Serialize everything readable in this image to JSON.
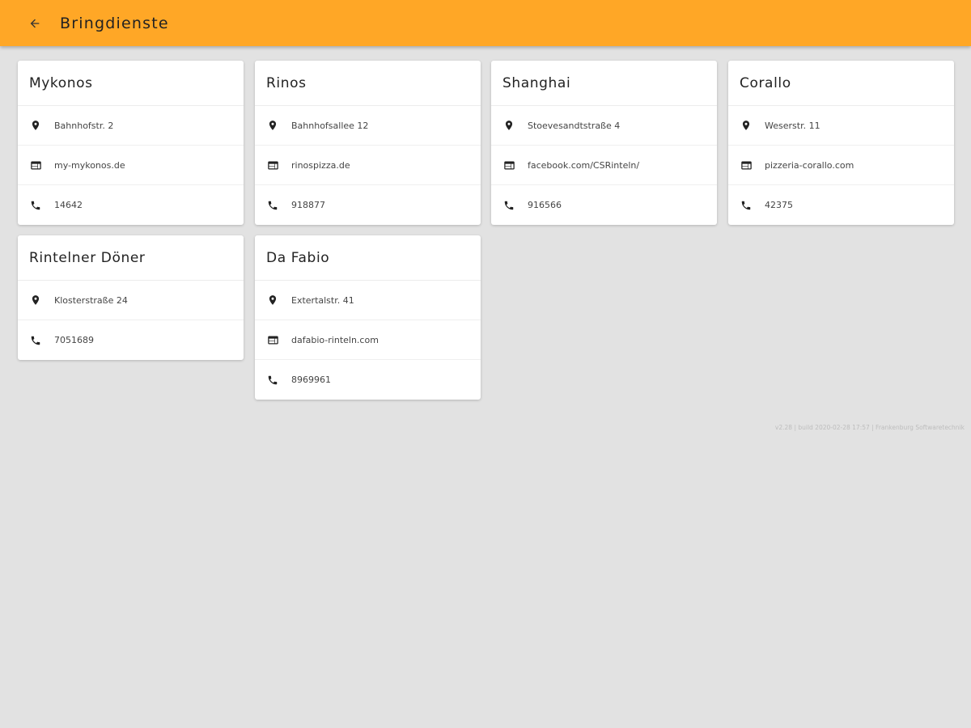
{
  "appbar": {
    "title": "Bringdienste",
    "color": "#ffa726"
  },
  "restaurants": [
    {
      "name": "Mykonos",
      "address": "Bahnhofstr. 2",
      "website": "my-mykonos.de",
      "phone": "14642"
    },
    {
      "name": "Rinos",
      "address": "Bahnhofsallee 12",
      "website": "rinospizza.de",
      "phone": "918877"
    },
    {
      "name": "Shanghai",
      "address": "Stoevesandtstraße 4",
      "website": "facebook.com/CSRinteln/",
      "phone": "916566"
    },
    {
      "name": "Corallo",
      "address": "Weserstr. 11",
      "website": "pizzeria-corallo.com",
      "phone": "42375"
    },
    {
      "name": "Rintelner Döner",
      "address": "Klosterstraße 24",
      "phone": "7051689"
    },
    {
      "name": "Da Fabio",
      "address": "Extertalstr. 41",
      "website": "dafabio-rinteln.com",
      "phone": "8969961"
    }
  ],
  "footer": "v2.28 | build 2020-02-28 17:57 | Frankenburg Softwaretechnik",
  "icons": {
    "back": "arrow-back-icon",
    "address": "location-pin-icon",
    "website": "web-icon",
    "phone": "phone-icon"
  }
}
